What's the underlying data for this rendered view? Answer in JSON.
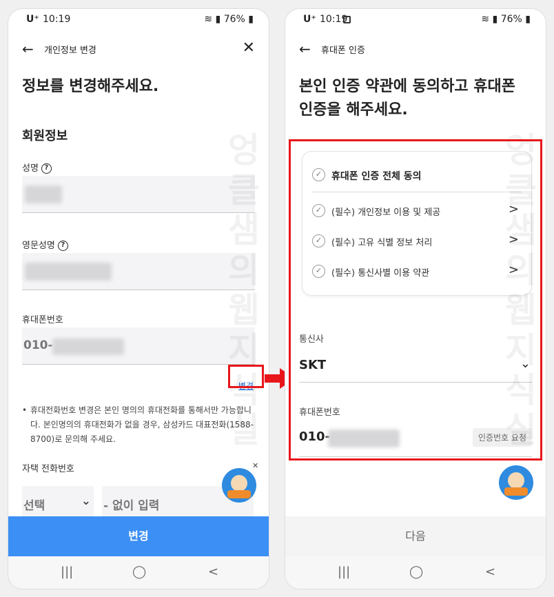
{
  "left": {
    "status": {
      "carrier": "U⁺",
      "time": "10:19",
      "battery": "76%"
    },
    "appbar": {
      "back": "←",
      "title": "개인정보 변경",
      "close": "✕"
    },
    "headline": "정보를 변경해주세요.",
    "section": "회원정보",
    "name_label": "성명",
    "eng_name_label": "영문성명",
    "help": "?",
    "phone_label": "휴대폰번호",
    "phone_prefix": "010-",
    "change_link": "변경",
    "note_bullet": "•",
    "note": "휴대전화번호 변경은 본인 명의의 휴대전화를 통해서만 가능합니다. 본인명의의 휴대전화가 없을 경우, 삼성카드 대표전화(1588-8700)로 문의해 주세요.",
    "home_phone_label": "자택 전화번호",
    "select_value": "선택",
    "input_placeholder": "- 없이 입력",
    "button": "변경"
  },
  "right": {
    "status": {
      "carrier": "U⁺",
      "time": "10:19",
      "battery": "76%"
    },
    "appbar": {
      "back": "←",
      "title": "휴대폰 인증"
    },
    "headline_line1": "본인 인증 약관에 동의하고 휴대폰",
    "headline_line2": "인증을 해주세요.",
    "agree_all": "휴대폰 인증 전체 동의",
    "agree_items": [
      "(필수) 개인정보 이용 및 제공",
      "(필수) 고유 식별 정보 처리",
      "(필수) 통신사별 이용 약관"
    ],
    "carrier_label": "통신사",
    "carrier_value": "SKT",
    "phone_label": "휴대폰번호",
    "phone_prefix": "010-",
    "verify_button": "인증번호 요청",
    "button": "다음"
  },
  "nav": {
    "recents": "|||",
    "home": "◯",
    "back": "<"
  },
  "icons": {
    "check": "✓",
    "chevron": ">",
    "dropdown": "⌄",
    "mascot_close": "✕"
  },
  "watermark": "엉클샘의 웹지식실",
  "colors": {
    "primary": "#3b8ff5",
    "highlight": "#e8161b",
    "link": "#1e6fd9"
  }
}
